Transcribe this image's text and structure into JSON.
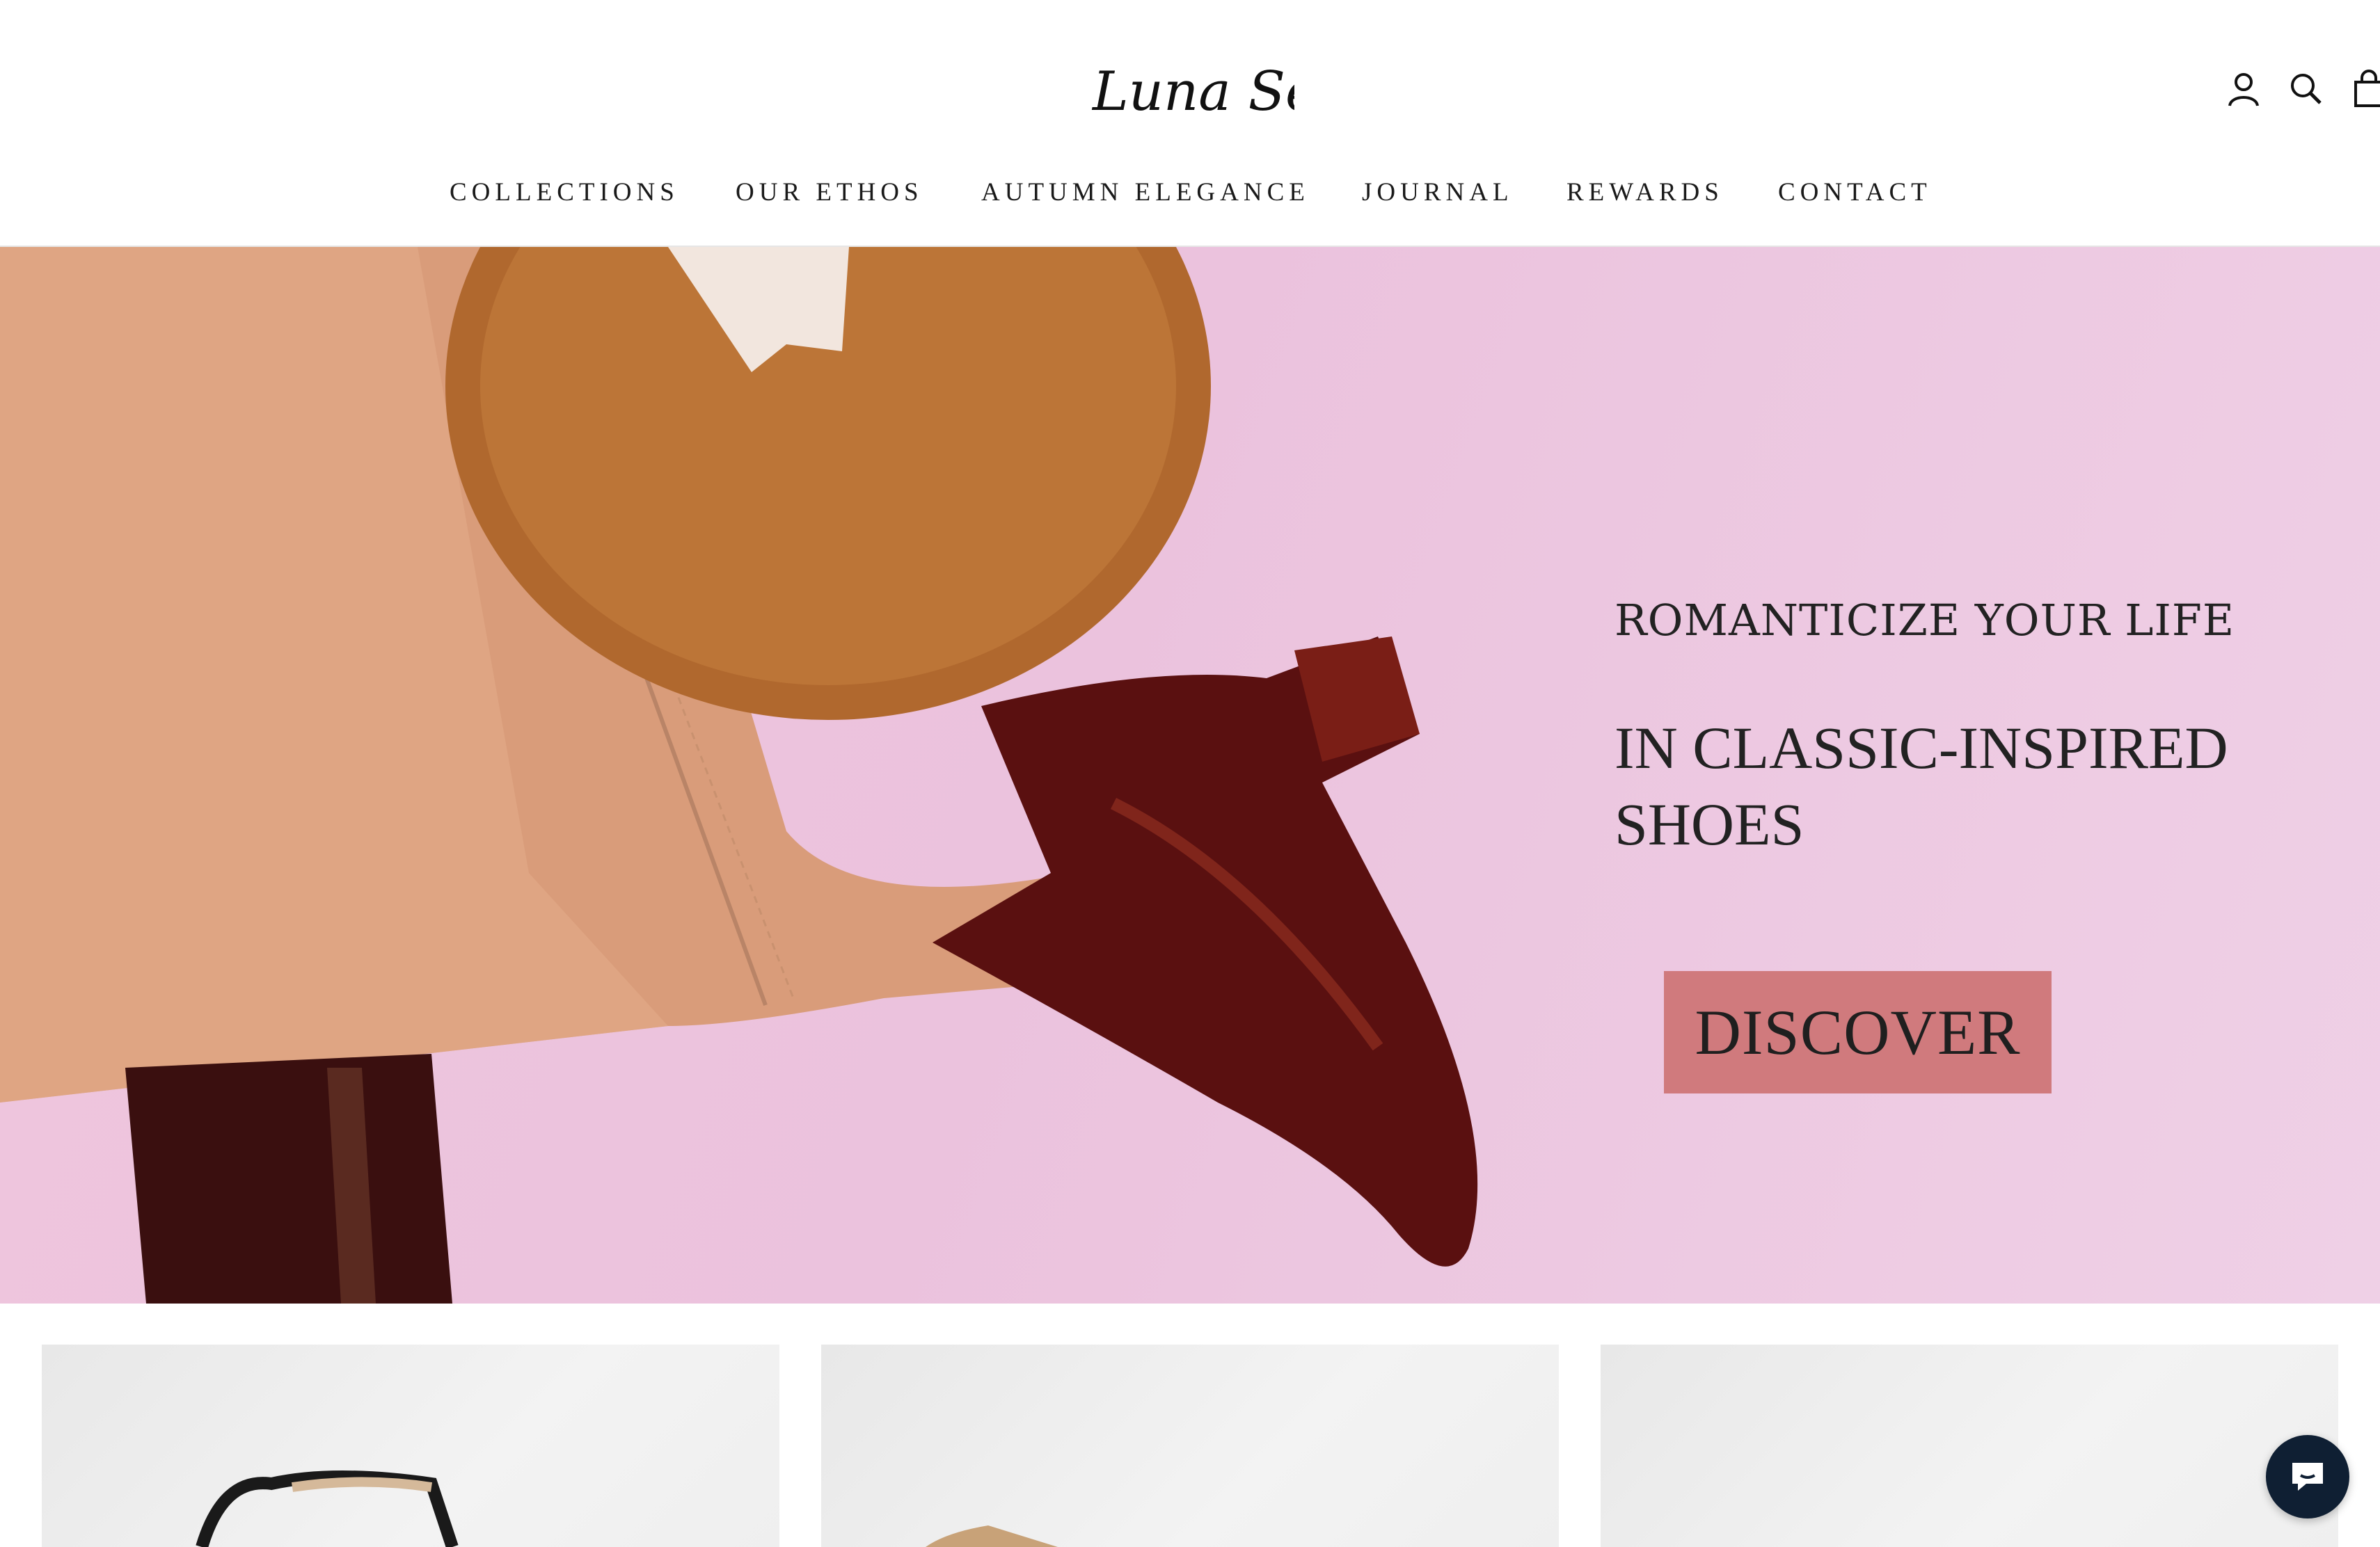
{
  "brand": {
    "logo_text": "Luna Selene"
  },
  "header": {
    "icons": [
      "account-icon",
      "search-icon",
      "cart-icon"
    ]
  },
  "nav": {
    "items": [
      "COLLECTIONS",
      "OUR ETHOS",
      "AUTUMN ELEGANCE",
      "JOURNAL",
      "REWARDS",
      "CONTACT"
    ]
  },
  "hero": {
    "title": "ROMANTICIZE YOUR LIFE",
    "subtitle": "IN CLASSIC-INSPIRED SHOES",
    "cta_label": "DISCOVER",
    "colors": {
      "background": "#ebc2dd",
      "cta": "#d07a7d"
    }
  },
  "products": {
    "cards": [
      "product-card-1",
      "product-card-2",
      "product-card-3"
    ]
  },
  "chat": {
    "icon": "chat-bubble-icon",
    "color": "#0f1f33"
  }
}
